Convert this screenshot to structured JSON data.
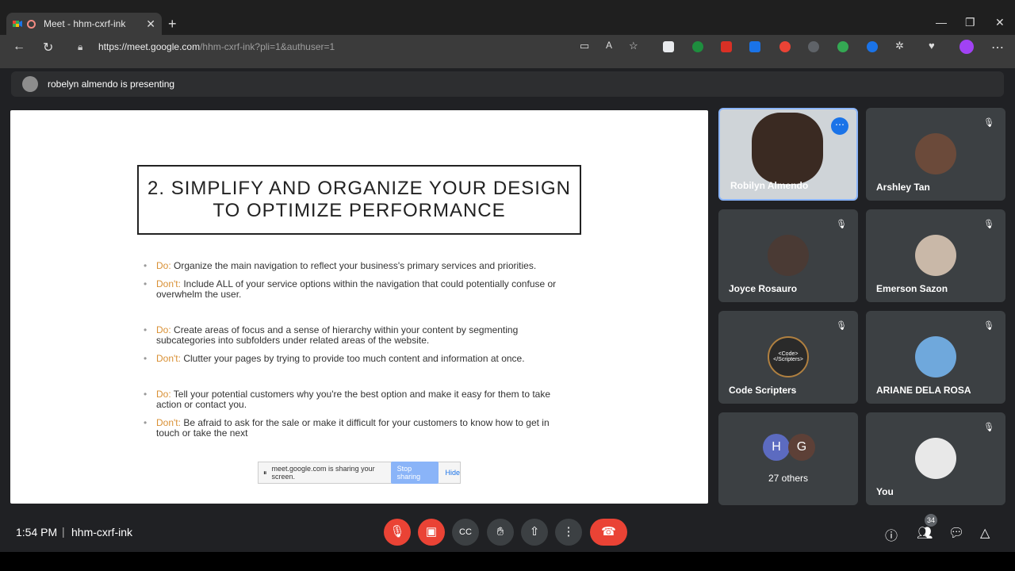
{
  "browser": {
    "tab_title": "Meet - hhm-cxrf-ink",
    "url_host": "https://meet.google.com",
    "url_path": "/hhm-cxrf-ink?pli=1&authuser=1"
  },
  "banner": {
    "text": "robelyn almendo is presenting"
  },
  "slide": {
    "title": "2. SIMPLIFY AND ORGANIZE YOUR DESIGN TO OPTIMIZE PERFORMANCE",
    "bullets": [
      {
        "label": "Do:",
        "text": " Organize the main navigation to reflect your business's primary services and priorities."
      },
      {
        "label": "Don't:",
        "text": " Include ALL of your service options within the navigation that could potentially confuse or overwhelm the user."
      },
      {
        "label": "Do:",
        "text": " Create areas of focus and a sense of hierarchy within your content by segmenting subcategories into subfolders under related areas of the website."
      },
      {
        "label": "Don't:",
        "text": " Clutter your pages by trying to provide too much content and information at once."
      },
      {
        "label": "Do:",
        "text": "  Tell your potential customers why you're the best option and make it easy for them to take action or contact you."
      },
      {
        "label": "Don't:",
        "text": " Be afraid to ask for the sale or make it difficult for your customers to know how to get in touch or take the next"
      }
    ]
  },
  "share_bar": {
    "text": "meet.google.com is sharing your screen.",
    "stop_label": "Stop sharing",
    "hide_label": "Hide"
  },
  "participants": [
    {
      "name": "Robilyn Almendo"
    },
    {
      "name": "Arshley Tan"
    },
    {
      "name": "Joyce Rosauro"
    },
    {
      "name": "Emerson Sazon"
    },
    {
      "name": "Code Scripters",
      "avatar_text": "<Code> </Scripters>"
    },
    {
      "name": "ARIANE DELA ROSA"
    },
    {
      "name": "27 others",
      "initials": [
        "H",
        "G"
      ]
    },
    {
      "name": "You"
    }
  ],
  "bottom": {
    "time": "1:54 PM",
    "meeting_code": "hhm-cxrf-ink",
    "people_count": "34"
  },
  "colors": {
    "accent": "#8ab4f8",
    "danger": "#ea4335",
    "label_orange": "#d99034"
  }
}
